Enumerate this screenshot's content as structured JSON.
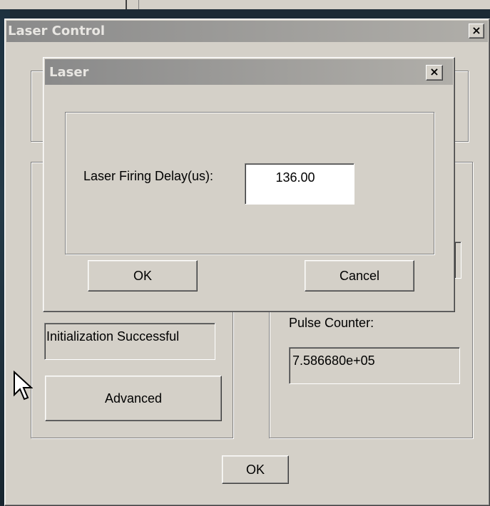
{
  "outer_window": {
    "title": "Laser Control",
    "close_glyph": "×",
    "status_text": "Initialization Successful",
    "advanced_label": "Advanced",
    "pulse_counter_label": "Pulse Counter:",
    "pulse_counter_value": "7.586680e+05",
    "ok_label": "OK"
  },
  "laser_dialog": {
    "title": "Laser",
    "close_glyph": "×",
    "delay_label": "Laser Firing Delay(us):",
    "delay_value": "136.00",
    "ok_label": "OK",
    "cancel_label": "Cancel"
  },
  "cursor": {
    "icon": "arrow-pointer-icon"
  }
}
